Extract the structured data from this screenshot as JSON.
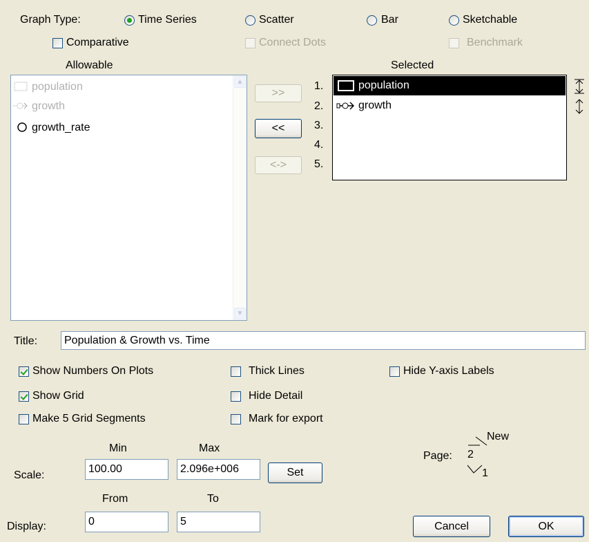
{
  "graph_type": {
    "label": "Graph Type:",
    "options": [
      {
        "label": "Time Series",
        "selected": true
      },
      {
        "label": "Scatter",
        "selected": false
      },
      {
        "label": "Bar",
        "selected": false
      },
      {
        "label": "Sketchable",
        "selected": false
      }
    ]
  },
  "sub_options": {
    "comparative": {
      "label": "Comparative",
      "checked": false,
      "enabled": true
    },
    "connect_dots": {
      "label": "Connect Dots",
      "checked": false,
      "enabled": false
    },
    "benchmark": {
      "label": "Benchmark",
      "checked": false,
      "enabled": false
    }
  },
  "allowable": {
    "header": "Allowable",
    "items": [
      {
        "label": "population",
        "enabled": false,
        "icon": "box-icon"
      },
      {
        "label": "growth",
        "enabled": false,
        "icon": "flow-icon"
      },
      {
        "label": "growth_rate",
        "enabled": true,
        "icon": "circle-icon"
      }
    ]
  },
  "transfer_buttons": {
    "add": ">>",
    "remove": "<<",
    "swap": "<->"
  },
  "selected": {
    "header": "Selected",
    "numbers": [
      "1.",
      "2.",
      "3.",
      "4.",
      "5."
    ],
    "items": [
      {
        "label": "population",
        "icon": "box-icon",
        "active": true
      },
      {
        "label": "growth",
        "icon": "flow-icon",
        "active": false
      }
    ]
  },
  "title": {
    "label": "Title:",
    "value": "Population & Growth vs. Time"
  },
  "options": {
    "show_numbers": {
      "label": "Show Numbers On Plots",
      "checked": true
    },
    "show_grid": {
      "label": "Show Grid",
      "checked": true
    },
    "five_grid": {
      "label": "Make 5 Grid Segments",
      "checked": false
    },
    "thick_lines": {
      "label": "Thick Lines",
      "checked": false
    },
    "hide_detail": {
      "label": "Hide Detail",
      "checked": false
    },
    "mark_export": {
      "label": "Mark for export",
      "checked": false
    },
    "hide_y_labels": {
      "label": "Hide Y-axis Labels",
      "checked": false
    }
  },
  "scale": {
    "label": "Scale:",
    "min_header": "Min",
    "max_header": "Max",
    "min_value": "100.00",
    "max_value": "2.096e+006",
    "set_label": "Set"
  },
  "display": {
    "label": "Display:",
    "from_header": "From",
    "to_header": "To",
    "from_value": "0",
    "to_value": "5"
  },
  "page": {
    "label": "Page:",
    "value": "2",
    "new_label": "New",
    "prev_label": "1"
  },
  "buttons": {
    "cancel": "Cancel",
    "ok": "OK"
  },
  "colors": {
    "dialog_bg": "#ece9d8",
    "radio_checked": "#21a121",
    "selection_bg": "#000000"
  }
}
